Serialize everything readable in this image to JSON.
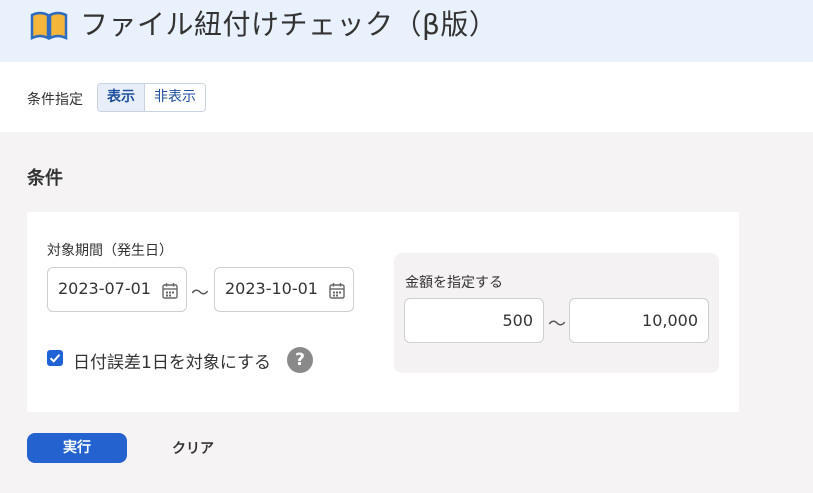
{
  "header": {
    "title": "ファイル紐付けチェック（β版）"
  },
  "toggle": {
    "label": "条件指定",
    "show": "表示",
    "hide": "非表示"
  },
  "section": {
    "title": "条件"
  },
  "period": {
    "label": "対象期間（発生日）",
    "from": "2023-07-01",
    "to": "2023-10-01",
    "separator": "〜"
  },
  "tolerance": {
    "label": "日付誤差1日を対象にする",
    "checked": true,
    "help": "?"
  },
  "amount": {
    "label": "金額を指定する",
    "min": "500",
    "max": "10,000",
    "separator": "〜"
  },
  "actions": {
    "run": "実行",
    "clear": "クリア"
  },
  "colors": {
    "accent": "#2463cf",
    "header_bg": "#e8f1fc"
  }
}
